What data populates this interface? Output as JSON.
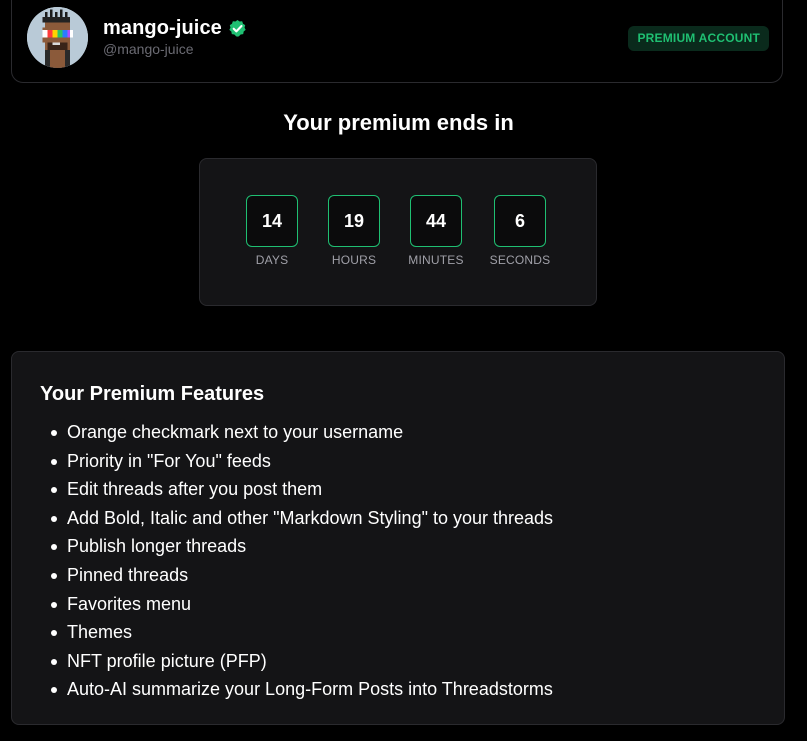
{
  "profile": {
    "username": "mango-juice",
    "handle": "@mango-juice",
    "badge": "PREMIUM ACCOUNT",
    "verified_icon": "check-circle-icon",
    "verified_color": "#1fbf72"
  },
  "countdown": {
    "title": "Your premium ends in",
    "units": [
      {
        "value": "14",
        "label": "DAYS"
      },
      {
        "value": "19",
        "label": "HOURS"
      },
      {
        "value": "44",
        "label": "MINUTES"
      },
      {
        "value": "6",
        "label": "SECONDS"
      }
    ],
    "accent": "#1fbf72"
  },
  "features": {
    "title": "Your Premium Features",
    "items": [
      "Orange checkmark next to your username",
      "Priority in \"For You\" feeds",
      "Edit threads after you post them",
      "Add Bold, Italic and other \"Markdown Styling\" to your threads",
      "Publish longer threads",
      "Pinned threads",
      "Favorites menu",
      "Themes",
      "NFT profile picture (PFP)",
      "Auto-AI summarize your Long-Form Posts into Threadstorms"
    ]
  }
}
